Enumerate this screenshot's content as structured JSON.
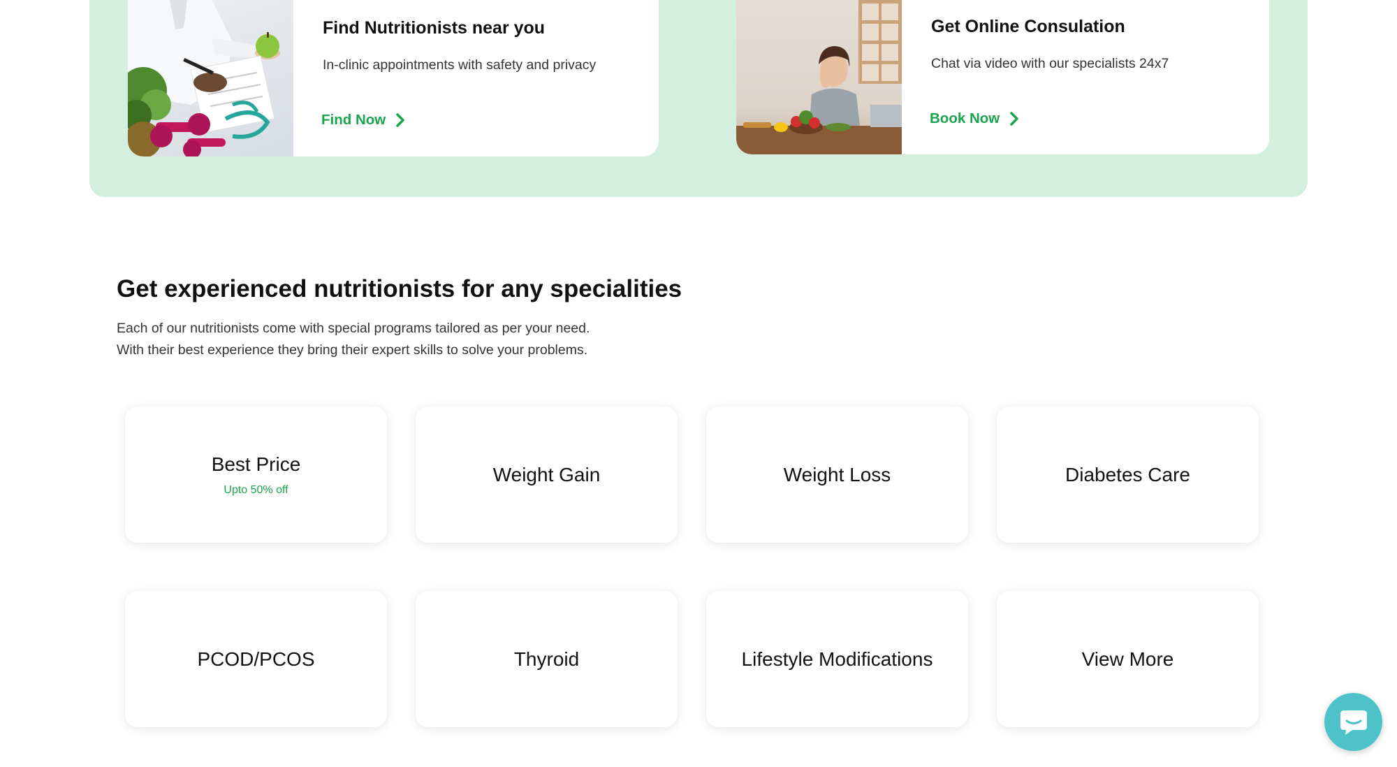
{
  "services": [
    {
      "title": "Find Nutritionists near you",
      "description": "In-clinic appointments with safety and privacy",
      "link_label": "Find Now",
      "image_alt": "nutritionist with fruits and dumbbells"
    },
    {
      "title": "Get Online Consulation",
      "description": "Chat via video with our specialists 24x7",
      "link_label": "Book Now",
      "image_alt": "woman on phone call with vegetables"
    }
  ],
  "section": {
    "title": "Get experienced nutritionists for any specialities",
    "description_line1": "Each of our nutritionists come with special programs tailored as per your need.",
    "description_line2": "With their best experience they bring their expert skills to solve your problems."
  },
  "specialities": [
    {
      "label": "Best Price",
      "sub": "Upto 50% off"
    },
    {
      "label": "Weight Gain"
    },
    {
      "label": "Weight Loss"
    },
    {
      "label": "Diabetes Care"
    },
    {
      "label": "PCOD/PCOS"
    },
    {
      "label": "Thyroid"
    },
    {
      "label": "Lifestyle Modifications"
    },
    {
      "label": "View More"
    }
  ],
  "colors": {
    "accent_green": "#1aa44d",
    "band_green": "#d3efe0",
    "chat_teal": "#4dc3c9"
  },
  "chat": {
    "icon": "chat-bubble-icon"
  }
}
